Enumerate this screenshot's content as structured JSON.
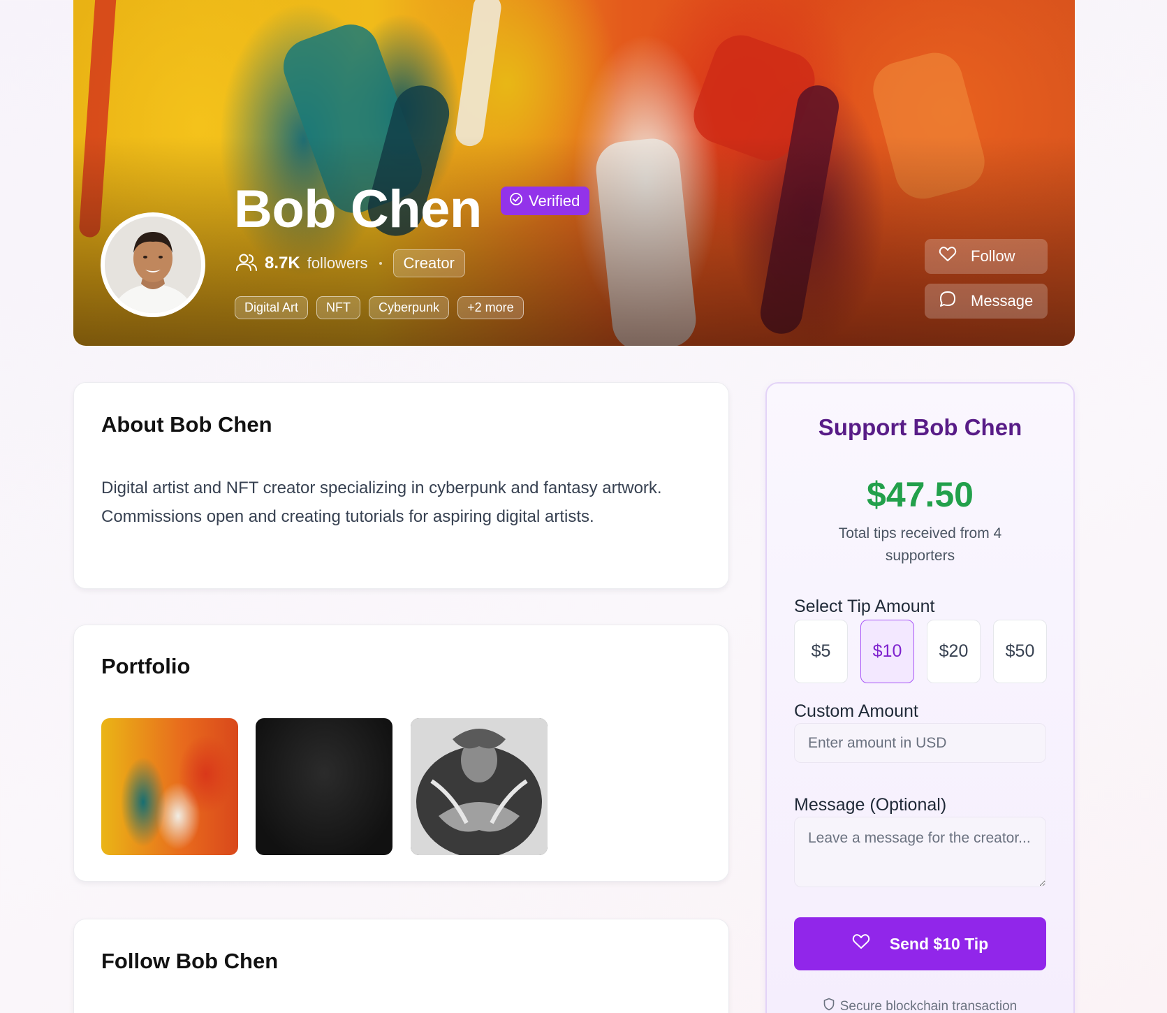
{
  "profile": {
    "name": "Bob Chen",
    "verified_label": "Verified",
    "followers_count": "8.7K",
    "followers_label": "followers",
    "role": "Creator",
    "tags": [
      "Digital Art",
      "NFT",
      "Cyberpunk",
      "+2 more"
    ],
    "follow_label": "Follow",
    "message_label": "Message"
  },
  "about": {
    "title": "About Bob Chen",
    "text": "Digital artist and NFT creator specializing in cyberpunk and fantasy artwork. Commissions open and creating tutorials for aspiring digital artists."
  },
  "portfolio": {
    "title": "Portfolio"
  },
  "follow_section": {
    "title": "Follow Bob Chen"
  },
  "support": {
    "title": "Support Bob Chen",
    "total": "$47.50",
    "caption": "Total tips received from 4 supporters",
    "select_label": "Select Tip Amount",
    "amounts": [
      "$5",
      "$10",
      "$20",
      "$50"
    ],
    "selected_amount": "$10",
    "custom_label": "Custom Amount",
    "custom_placeholder": "Enter amount in USD",
    "message_label": "Message (Optional)",
    "message_placeholder": "Leave a message for the creator...",
    "send_label": "Send $10 Tip",
    "secure_label": "Secure blockchain transaction"
  },
  "colors": {
    "accent": "#9333ea",
    "support_title": "#581c87",
    "tip_total": "#22a04b"
  }
}
